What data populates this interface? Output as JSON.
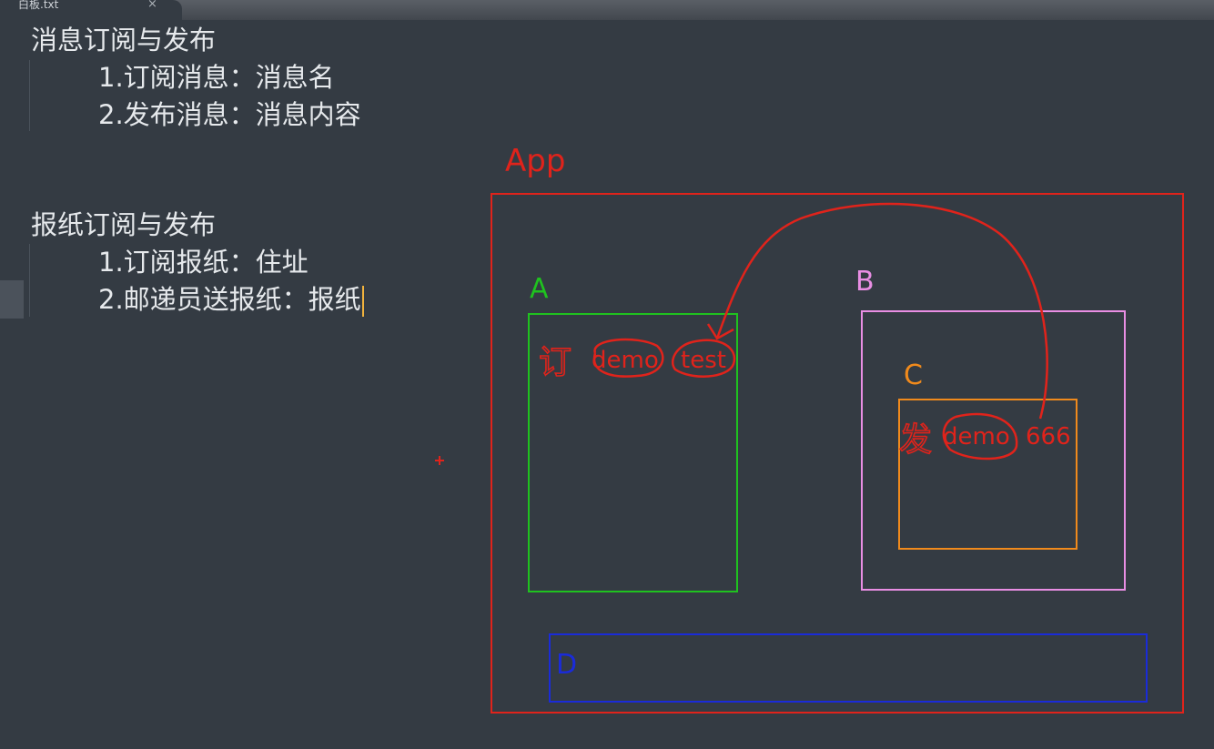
{
  "tab": {
    "title": "白板.txt",
    "close": "×"
  },
  "editor": {
    "section1": {
      "heading": "消息订阅与发布",
      "items": [
        "1.订阅消息：消息名",
        "2.发布消息：消息内容"
      ]
    },
    "section2": {
      "heading": "报纸订阅与发布",
      "items": [
        "1.订阅报纸：住址",
        "2.邮递员送报纸：报纸"
      ]
    }
  },
  "drawing": {
    "app_label": "App",
    "box_a_label": "A",
    "box_b_label": "B",
    "box_c_label": "C",
    "box_d_label": "D",
    "a_note": "订",
    "a_demo": "demo",
    "a_test": "test",
    "c_note": "发",
    "c_demo": "demo",
    "c_value": "666",
    "colors": {
      "app": "#e0231b",
      "a": "#1fc21f",
      "b": "#e98ee4",
      "c": "#f08a1c",
      "d": "#1a2bd9",
      "ink": "#e0231b"
    }
  }
}
